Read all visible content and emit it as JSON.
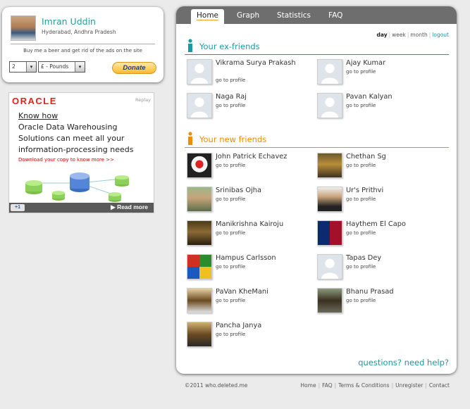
{
  "profile": {
    "name": "Imran Uddin",
    "location": "Hyderabad, Andhra Pradesh",
    "beer_text": "Buy me a beer and get rid of the ads on the site",
    "qty_value": "2",
    "currency_value": "£ - Pounds",
    "donate_label": "Donate",
    "dropdown_glyph": "▾"
  },
  "ad": {
    "brand": "ORACLE",
    "replay": "Replay",
    "lines": [
      "Know how",
      "Oracle Data Warehousing",
      "Solutions can meet all your",
      "information-processing needs"
    ],
    "cta": "Download your copy to know more >>",
    "plus": "+1",
    "more": "Read more"
  },
  "tabs": [
    "Home",
    "Graph",
    "Statistics",
    "FAQ"
  ],
  "filters": {
    "day": "day",
    "week": "week",
    "month": "month",
    "logout": "logout",
    "separator": "|"
  },
  "ex_friends": {
    "title": "Your ex-friends",
    "color": "#1a9aa0",
    "items": [
      {
        "name": "Vikrama Surya Prakash",
        "link": "go to profile"
      },
      {
        "name": "Ajay Kumar",
        "link": "go to profile"
      },
      {
        "name": "Naga Raj",
        "link": "go to profile"
      },
      {
        "name": "Pavan Kalyan",
        "link": "go to profile"
      }
    ]
  },
  "new_friends": {
    "title": "Your new friends",
    "color": "#f08c00",
    "items": [
      {
        "name": "John Patrick Echavez",
        "link": "go to profile"
      },
      {
        "name": "Chethan Sg",
        "link": "go to profile"
      },
      {
        "name": "Srinibas Ojha",
        "link": "go to profile"
      },
      {
        "name": "Ur's Prithvi",
        "link": "go to profile"
      },
      {
        "name": "Manikrishna Kairoju",
        "link": "go to profile"
      },
      {
        "name": "Haythem El Capo",
        "link": "go to profile"
      },
      {
        "name": "Hampus Carlsson",
        "link": "go to profile"
      },
      {
        "name": "Tapas Dey",
        "link": "go to profile"
      },
      {
        "name": "PaVan KheMani",
        "link": "go to profile"
      },
      {
        "name": "Bhanu Prasad",
        "link": "go to profile"
      },
      {
        "name": "Pancha Janya",
        "link": "go to profile"
      }
    ]
  },
  "help": "questions? need help?",
  "footer": {
    "copyright": "©2011 who.deleted.me",
    "links": [
      "Home",
      "FAQ",
      "Terms & Conditions",
      "Unregister",
      "Contact"
    ],
    "separator": "|"
  }
}
